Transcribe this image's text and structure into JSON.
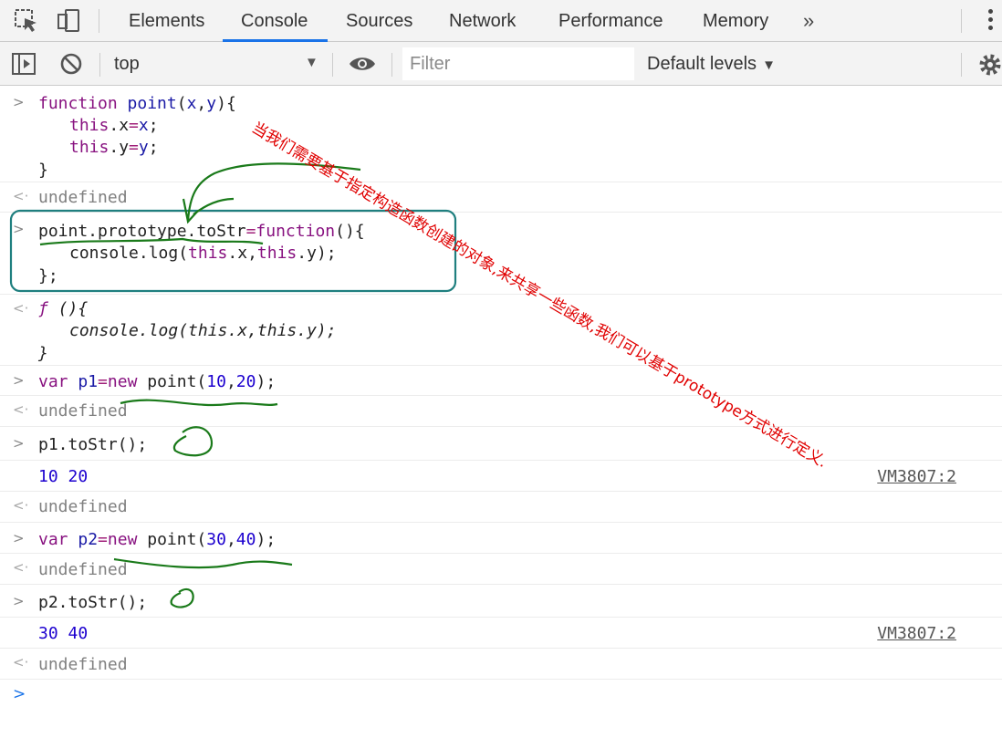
{
  "tabs": [
    {
      "label": "Elements"
    },
    {
      "label": "Console",
      "active": true
    },
    {
      "label": "Sources"
    },
    {
      "label": "Network"
    },
    {
      "label": "Performance"
    },
    {
      "label": "Memory"
    }
  ],
  "more_tabs": "»",
  "toolbar": {
    "context": "top",
    "filter_placeholder": "Filter",
    "levels": "Default levels"
  },
  "console": {
    "entry1": {
      "l1": {
        "a": "function",
        "b": "point",
        "c": "(",
        "d": "x",
        "e": ",",
        "f": "y",
        "g": "){"
      },
      "l2": {
        "a": "this",
        "b": ".x",
        "c": "=",
        "d": "x",
        "e": ";"
      },
      "l3": {
        "a": "this",
        "b": ".y",
        "c": "=",
        "d": "y",
        "e": ";"
      },
      "l4": "}",
      "result": "undefined"
    },
    "entry2": {
      "l1": {
        "a": "point.prototype.toStr",
        "b": "=",
        "c": "function",
        "d": "(){"
      },
      "l2": {
        "a": "console.log(",
        "b": "this",
        "c": ".x,",
        "d": "this",
        "e": ".y);"
      },
      "l3": "};",
      "result_l1": {
        "a": "ƒ",
        "b": " (){"
      },
      "result_l2": "console.log(this.x,this.y);",
      "result_l3": "}"
    },
    "entry3": {
      "a": "var",
      "b": "p1",
      "c": "=",
      "d": "new",
      "e": " point(",
      "f": "10",
      "g": ",",
      "h": "20",
      "i": ");",
      "result": "undefined"
    },
    "entry4": {
      "cmd": "p1.toStr();",
      "log": "10 20",
      "source": "VM3807:2",
      "result": "undefined"
    },
    "entry5": {
      "a": "var",
      "b": "p2",
      "c": "=",
      "d": "new",
      "e": " point(",
      "f": "30",
      "g": ",",
      "h": "40",
      "i": ");",
      "result": "undefined"
    },
    "entry6": {
      "cmd": "p2.toStr();",
      "log": "30 40",
      "source": "VM3807:2",
      "result": "undefined"
    }
  },
  "annotation": {
    "text": "当我们需要基于指定构造函数创建的对象,来共享一些函数,我们可以基于prototype方式进行定义.",
    "color": "#e00000",
    "mark_color": "#1a7a1a",
    "box_color": "#1f7f7f"
  },
  "colors": {
    "keyword": "#881280",
    "function_name": "#1a1aa6",
    "number": "#1c00cf",
    "accent": "#1a73e8"
  }
}
